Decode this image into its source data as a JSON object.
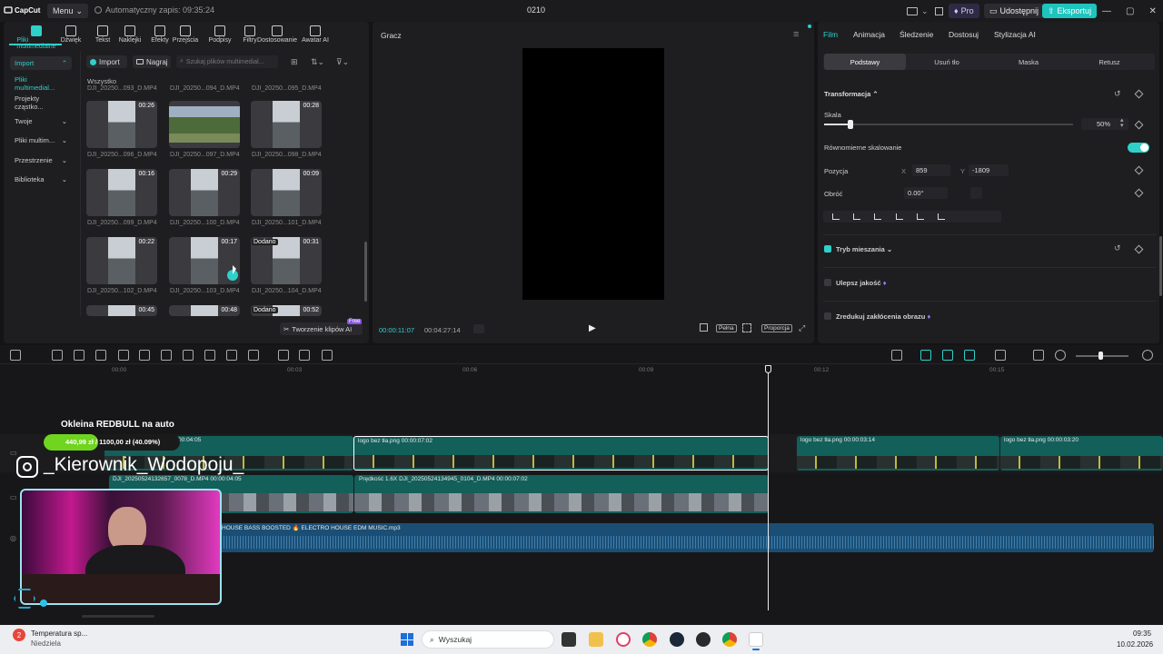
{
  "titlebar": {
    "app": "CapCut",
    "menu": "Menu",
    "autosave": "Automatyczny zapis: 09:35:24",
    "project": "0210",
    "pro": "Pro",
    "share": "Udostępnij",
    "export": "Eksportuj"
  },
  "toolbar": {
    "items": [
      {
        "label": "Pliki multimedialne",
        "icon": "media-icon"
      },
      {
        "label": "Dźwięk",
        "icon": "audio-icon"
      },
      {
        "label": "Tekst",
        "icon": "text-icon"
      },
      {
        "label": "Naklejki",
        "icon": "sticker-icon"
      },
      {
        "label": "Efekty",
        "icon": "effects-icon"
      },
      {
        "label": "Przejścia",
        "icon": "transition-icon"
      },
      {
        "label": "Podpisy",
        "icon": "captions-icon"
      },
      {
        "label": "Filtry",
        "icon": "filter-icon"
      },
      {
        "label": "Dostosowanie",
        "icon": "adjust-icon"
      },
      {
        "label": "Awatar AI",
        "icon": "avatar-icon"
      }
    ]
  },
  "sidebar": {
    "items": [
      "Import",
      "Pliki multimedial...",
      "Projekty cząstko...",
      "Twoje",
      "Pliki multim...",
      "Przestrzenie",
      "Biblioteka"
    ]
  },
  "media": {
    "import": "Import",
    "record": "Nagraj",
    "search_placeholder": "Szukaj plików multimedial...",
    "section": "Wszystko",
    "top_labels": [
      "DJI_20250...093_D.MP4",
      "DJI_20250...094_D.MP4",
      "DJI_20250...095_D.MP4"
    ],
    "rows": [
      [
        {
          "name": "DJI_20250...096_D.MP4",
          "dur": "00:26"
        },
        {
          "name": "DJI_20250...097_D.MP4",
          "dur": ""
        },
        {
          "name": "DJI_20250...098_D.MP4",
          "dur": "00:28"
        }
      ],
      [
        {
          "name": "DJI_20250...099_D.MP4",
          "dur": "00:16"
        },
        {
          "name": "DJI_20250...100_D.MP4",
          "dur": "00:29"
        },
        {
          "name": "DJI_20250...101_D.MP4",
          "dur": "00:09"
        }
      ],
      [
        {
          "name": "DJI_20250...102_D.MP4",
          "dur": "00:22"
        },
        {
          "name": "DJI_20250...103_D.MP4",
          "dur": "00:17"
        },
        {
          "name": "DJI_20250...104_D.MP4",
          "dur": "00:31"
        }
      ]
    ],
    "partial_durs": [
      "00:45",
      "00:48",
      "00:52"
    ],
    "added": "Dodano",
    "ai_clips": "Tworzenie klipów AI",
    "free": "Free"
  },
  "player": {
    "title": "Gracz",
    "current": "00:00:11:07",
    "total": "00:04:27:14",
    "full": "Pełna",
    "ratio": "Proporcja"
  },
  "right": {
    "tabs": [
      "Film",
      "Animacja",
      "Śledzenie",
      "Dostosuj",
      "Stylizacja AI"
    ],
    "subtabs": [
      "Podstawy",
      "Usuń tło",
      "Maska",
      "Retusz"
    ],
    "transform": "Transformacja",
    "scale": "Skala",
    "scale_val": "50%",
    "uniform": "Równomierne skalowanie",
    "position": "Pozycja",
    "x_label": "X",
    "x": "859",
    "y_label": "Y",
    "y": "-1809",
    "rotate": "Obróć",
    "rotate_val": "0.00°",
    "blend": "Tryb mieszania",
    "enhance": "Ulepsz jakość",
    "denoise": "Zredukuj zakłócenia obrazu"
  },
  "timeline": {
    "ruler": [
      "00:00",
      "00:03",
      "00:06",
      "00:09",
      "00:12",
      "00:15"
    ],
    "clips": {
      "overlay1": "logo bez tła.png  00:00:07:02",
      "overlay2": "logo bez tła.png  00:00:03:14",
      "overlay3": "logo bez tła.png  00:00:03:20",
      "overlay0_time": "00:00:04:05",
      "main1": "DJI_20250524132657_0078_D.MP4  00:00:04:05",
      "main2": "Prędkość 1.6X   DJI_20250524134945_0104_D.MP4  00:00:07:02",
      "audio": "HOUSE BASS BOOSTED 🔥 ELECTRO HOUSE EDM MUSIC.mp3"
    }
  },
  "stream": {
    "goal_title": "Okleina REDBULL na auto",
    "goal_progress": "440,99 zł / 1100,00 zł (40.09%)",
    "goal_fraction": 0.4009,
    "handle": "_Kierownik_Wodopoju_"
  },
  "taskbar": {
    "weather_title": "Temperatura sp...",
    "weather_sub": "Niedziela",
    "badge": "2",
    "search": "Wyszukaj",
    "time": "09:35",
    "date": "10.02.2026"
  },
  "colors": {
    "accent": "#2fd0c9",
    "export": "#1fc4be",
    "video_track": "#135f5a",
    "audio_track": "#1b4e74"
  }
}
